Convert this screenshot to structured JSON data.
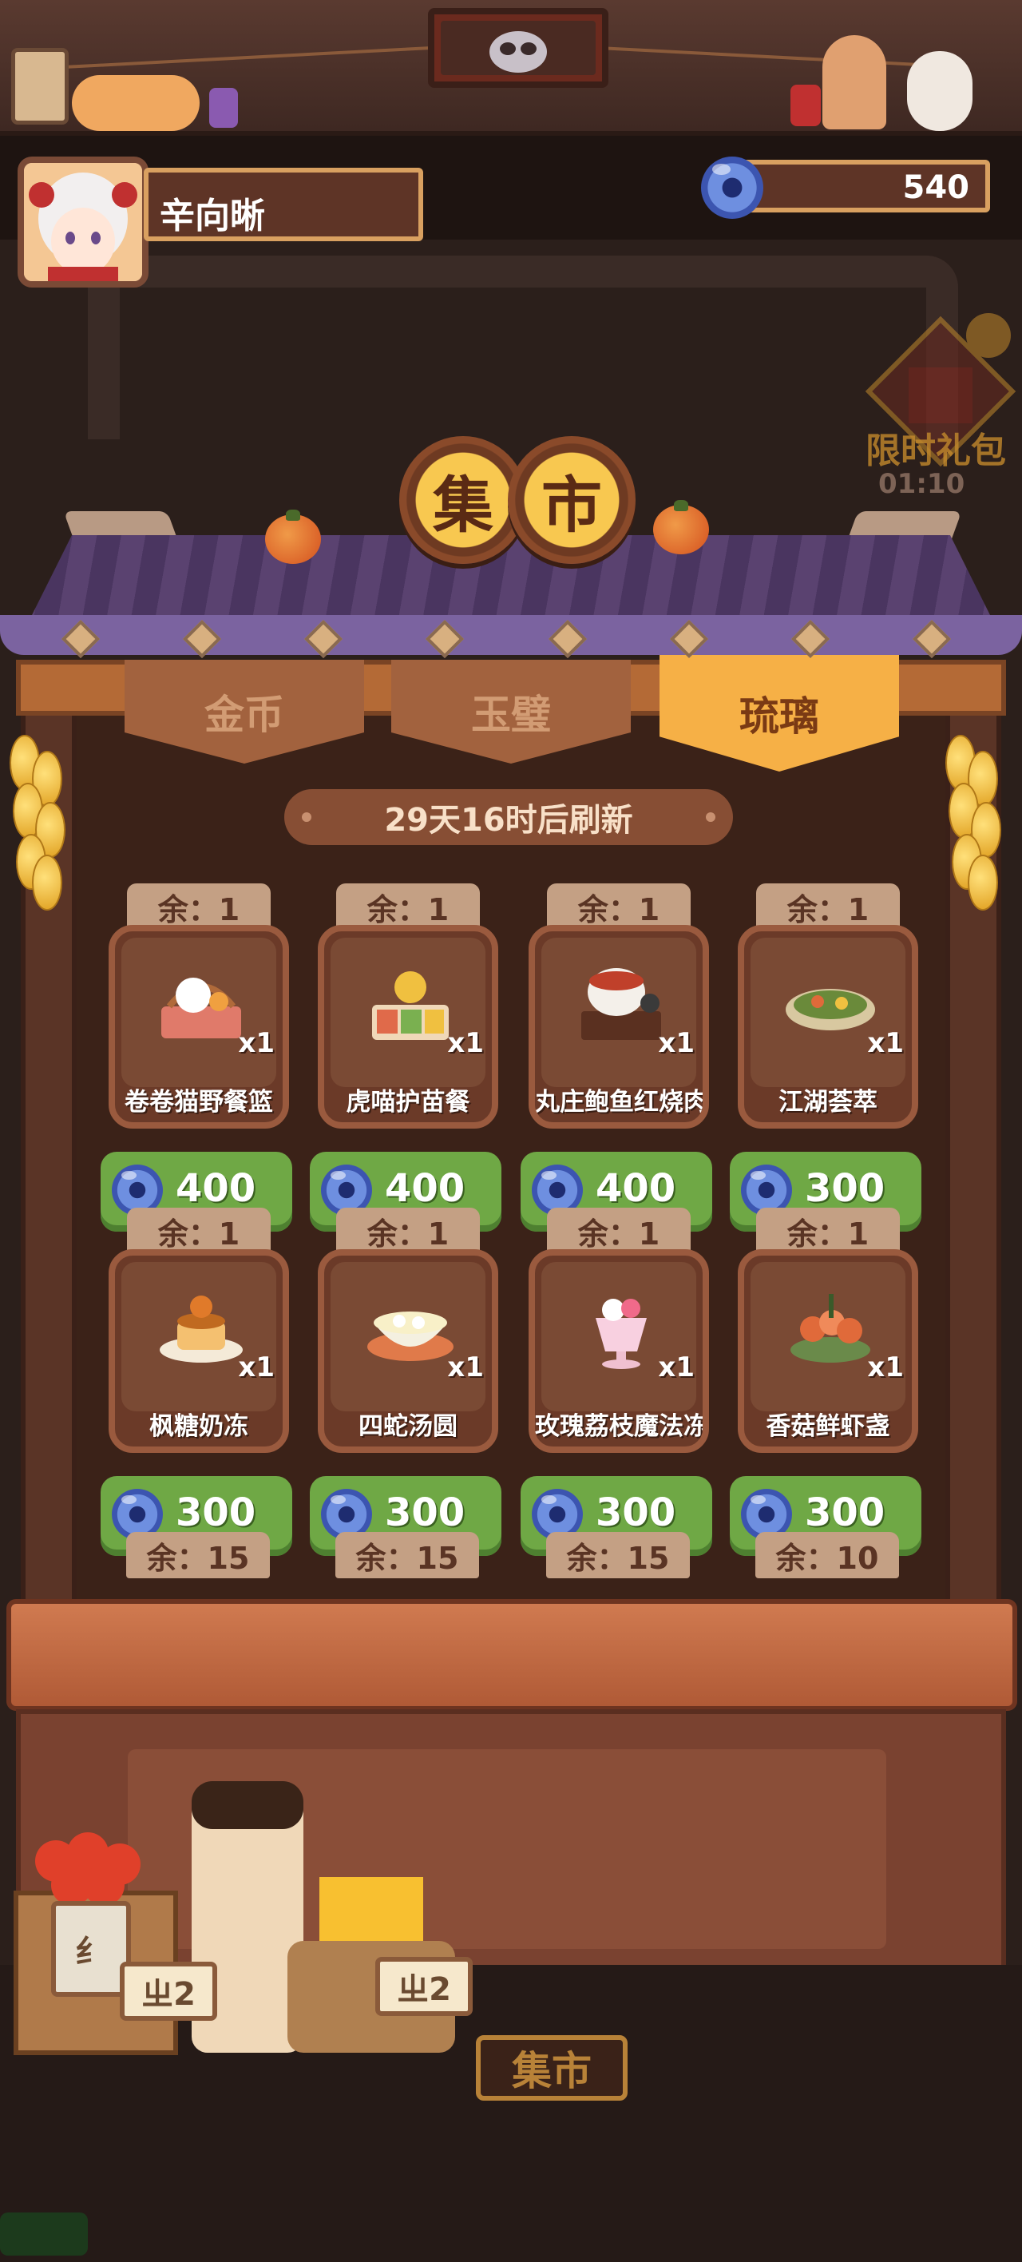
{
  "player": {
    "name": "辛向晰"
  },
  "currency": {
    "amount": "540",
    "icon": "liuli-gem-icon"
  },
  "side_event": {
    "label": "限时礼包",
    "timer": "01:10",
    "badge": "庚"
  },
  "shop": {
    "title_chars": [
      "集",
      "市"
    ],
    "tabs": [
      {
        "label": "金币",
        "active": false
      },
      {
        "label": "玉璧",
        "active": false
      },
      {
        "label": "琉璃",
        "active": true
      }
    ],
    "refresh_text": "29天16时后刷新",
    "stock_prefix": "余：",
    "items": [
      {
        "name": "卷卷猫野餐篮",
        "stock": "余：1",
        "qty": "x1",
        "price": "400"
      },
      {
        "name": "虎喵护苗餐",
        "stock": "余：1",
        "qty": "x1",
        "price": "400"
      },
      {
        "name": "丸庄鲍鱼红烧肉",
        "stock": "余：1",
        "qty": "x1",
        "price": "400"
      },
      {
        "name": "江湖荟萃",
        "stock": "余：1",
        "qty": "x1",
        "price": "300"
      },
      {
        "name": "枫糖奶冻",
        "stock": "余：1",
        "qty": "x1",
        "price": "300"
      },
      {
        "name": "四蛇汤圆",
        "stock": "余：1",
        "qty": "x1",
        "price": "300"
      },
      {
        "name": "玫瑰荔枝魔法冻",
        "stock": "余：1",
        "qty": "x1",
        "price": "300"
      },
      {
        "name": "香菇鲜虾盏",
        "stock": "余：1",
        "qty": "x1",
        "price": "300"
      }
    ],
    "partial_row_stock": [
      "余：15",
      "余：15",
      "余：15",
      "余：10"
    ]
  },
  "vendor": {
    "tag_left": "ㄓ2",
    "tag_right": "ㄓ2",
    "sign_left": "纟",
    "bottom_sign": "集市"
  },
  "colors": {
    "accent_gold": "#f6b046",
    "price_green": "#6fa845",
    "roof_purple": "#5a4270",
    "wood_brown": "#6b3a28"
  }
}
